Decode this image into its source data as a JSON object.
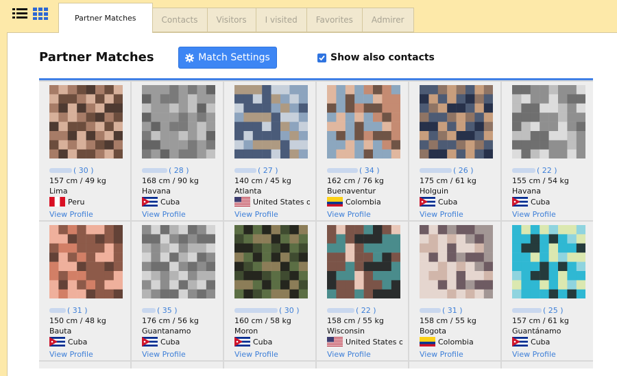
{
  "tabs": [
    "Partner Matches",
    "Contacts",
    "Visitors",
    "I visited",
    "Favorites",
    "Admirer"
  ],
  "page": {
    "title": "Partner Matches",
    "settings_label": "Match Settings",
    "show_contacts_label": "Show also contacts"
  },
  "profiles": [
    {
      "age": "( 30 )",
      "hw": "157 cm / 49 kg",
      "city": "Lima",
      "country": "Peru",
      "flag": "peru",
      "view": "View Profile",
      "colors": [
        "#6c4d3d",
        "#a77c67",
        "#d7b09a",
        "#4e3a31"
      ]
    },
    {
      "age": "( 28 )",
      "hw": "168 cm / 90 kg",
      "city": "Havana",
      "country": "Cuba",
      "flag": "cuba",
      "view": "View Profile",
      "colors": [
        "#9b9b9b",
        "#7a7a7a",
        "#c2c2c2",
        "#646464"
      ]
    },
    {
      "age": "( 27 )",
      "hw": "140 cm / 45 kg",
      "city": "Atlanta",
      "country": "United States o",
      "flag": "usa",
      "view": "View Profile",
      "colors": [
        "#8da4be",
        "#4a5b79",
        "#c7d0db",
        "#ae9a82"
      ]
    },
    {
      "age": "( 34 )",
      "hw": "162 cm / 76 kg",
      "city": "Buenaventur",
      "country": "Colombia",
      "flag": "colombia",
      "view": "View Profile",
      "colors": [
        "#c58b72",
        "#8ca7bf",
        "#e0b79f",
        "#6f5446"
      ]
    },
    {
      "age": "( 26 )",
      "hw": "175 cm / 61 kg",
      "city": "Holguin",
      "country": "Cuba",
      "flag": "cuba",
      "view": "View Profile",
      "colors": [
        "#4d5b74",
        "#c89e7d",
        "#8f7464",
        "#27314a"
      ]
    },
    {
      "age": "( 22 )",
      "hw": "155 cm / 54 kg",
      "city": "Havana",
      "country": "Cuba",
      "flag": "cuba",
      "view": "View Profile",
      "colors": [
        "#bfbfbf",
        "#8f8f8f",
        "#dcdcdc",
        "#6f6f6f"
      ]
    },
    {
      "age": "( 31 )",
      "hw": "150 cm / 48 kg",
      "city": "Bauta",
      "country": "Cuba",
      "flag": "cuba",
      "view": "View Profile",
      "colors": [
        "#d27f66",
        "#8d5a49",
        "#efb09c",
        "#634237"
      ]
    },
    {
      "age": "( 35 )",
      "hw": "176 cm / 56 kg",
      "city": "Guantanamo",
      "country": "Cuba",
      "flag": "cuba",
      "view": "View Profile",
      "colors": [
        "#d4d4d4",
        "#8c8c8c",
        "#b4b4b4",
        "#6f6f6f"
      ]
    },
    {
      "age": "( 30 )",
      "hw": "160 cm / 58 kg",
      "city": "Moron",
      "country": "Cuba",
      "flag": "cuba",
      "view": "View Profile",
      "colors": [
        "#3f4b30",
        "#8c7d58",
        "#25261e",
        "#5b6e44"
      ]
    },
    {
      "age": "( 22 )",
      "hw": "158 cm / 55 kg",
      "city": "Wisconsin",
      "country": "United States o",
      "flag": "usa",
      "view": "View Profile",
      "colors": [
        "#2a2d2d",
        "#e9c7b8",
        "#7b5448",
        "#4a8c8c"
      ]
    },
    {
      "age": "( 31 )",
      "hw": "158 cm / 55 kg",
      "city": "Bogota",
      "country": "Colombia",
      "flag": "colombia",
      "view": "View Profile",
      "colors": [
        "#d1b6aa",
        "#6e5b62",
        "#a29694",
        "#e5d6cf"
      ]
    },
    {
      "age": "( 25 )",
      "hw": "157 cm / 61 kg",
      "city": "Guantánamo",
      "country": "Cuba",
      "flag": "cuba",
      "view": "View Profile",
      "colors": [
        "#2fb8d3",
        "#253b3c",
        "#dbe8b0",
        "#8fd4df"
      ]
    }
  ]
}
